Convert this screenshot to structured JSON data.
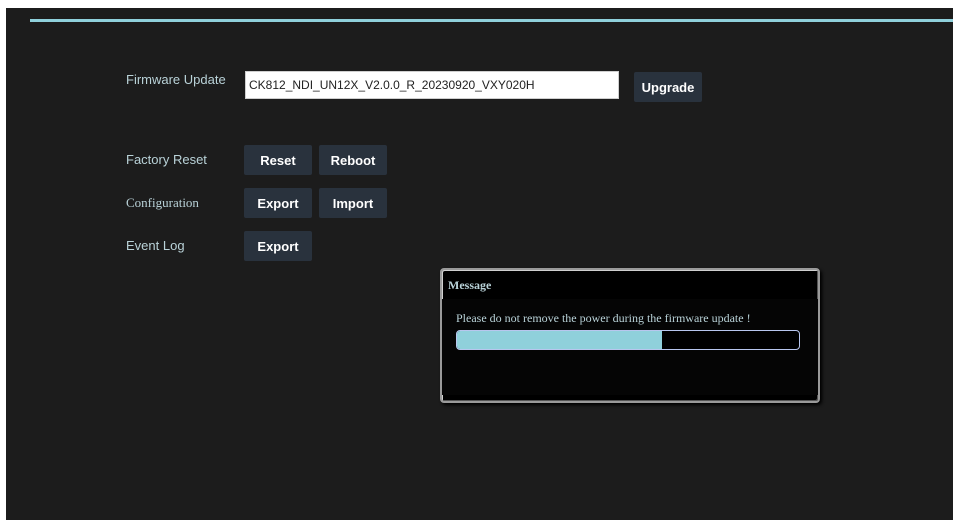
{
  "firmware_update": {
    "label": "Firmware Update",
    "filename": "CK812_NDI_UN12X_V2.0.0_R_20230920_VXY020H",
    "upgrade_label": "Upgrade"
  },
  "factory_reset": {
    "label": "Factory Reset",
    "reset_label": "Reset",
    "reboot_label": "Reboot"
  },
  "configuration": {
    "label": "Configuration",
    "export_label": "Export",
    "import_label": "Import"
  },
  "event_log": {
    "label": "Event Log",
    "export_label": "Export"
  },
  "message_dialog": {
    "title": "Message",
    "text": "Please do not remove the power during the firmware update !",
    "progress_fraction": 0.6
  },
  "colors": {
    "accent": "#8fd0db",
    "background": "#1c1c1c",
    "button": "#29323d"
  }
}
